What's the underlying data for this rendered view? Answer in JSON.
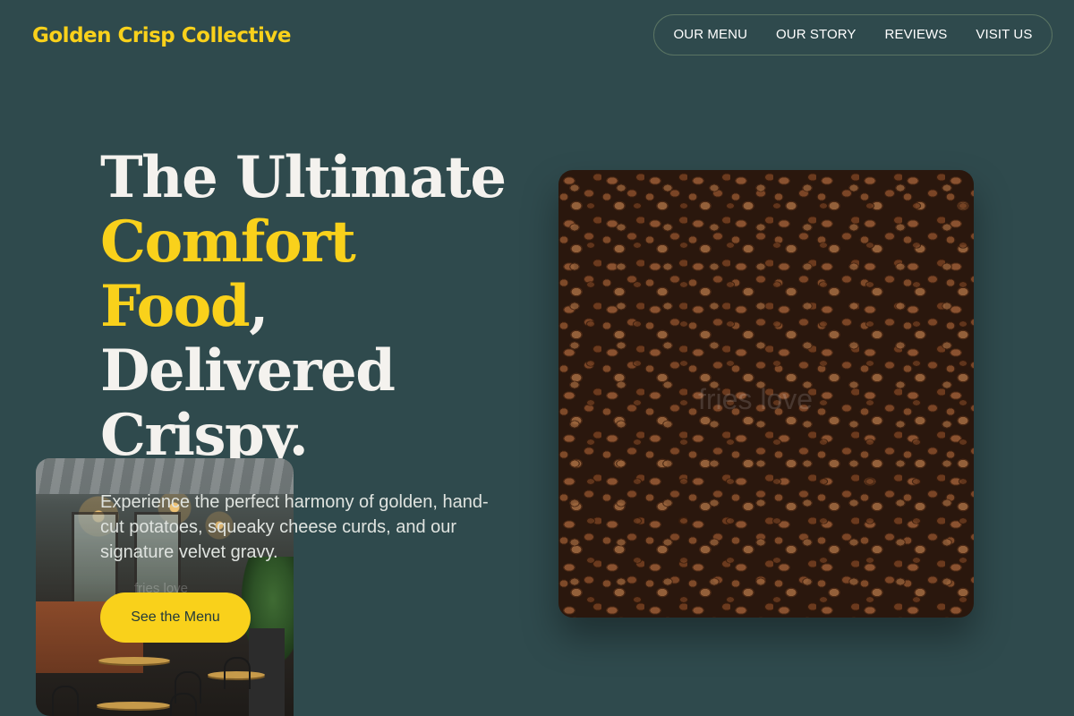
{
  "brand": {
    "name": "Golden Crisp Collective"
  },
  "nav": {
    "items": [
      {
        "label": "OUR MENU"
      },
      {
        "label": "OUR STORY"
      },
      {
        "label": "REVIEWS"
      },
      {
        "label": "VISIT US"
      }
    ]
  },
  "hero": {
    "headline": {
      "line1": "The Ultimate",
      "accent1": "Comfort",
      "accent2": "Food",
      "comma": ",",
      "line4": "Delivered",
      "line5": "Crispy."
    },
    "description": "Experience the perfect harmony of golden, hand-cut potatoes, squeaky cheese curds, and our signature velvet gravy.",
    "cta_label": "See the Menu",
    "watermark_small": "fries love",
    "watermark_large": "fries love"
  },
  "colors": {
    "background": "#2f4a4d",
    "accent": "#f9d11b",
    "text": "#f4f2ee"
  }
}
